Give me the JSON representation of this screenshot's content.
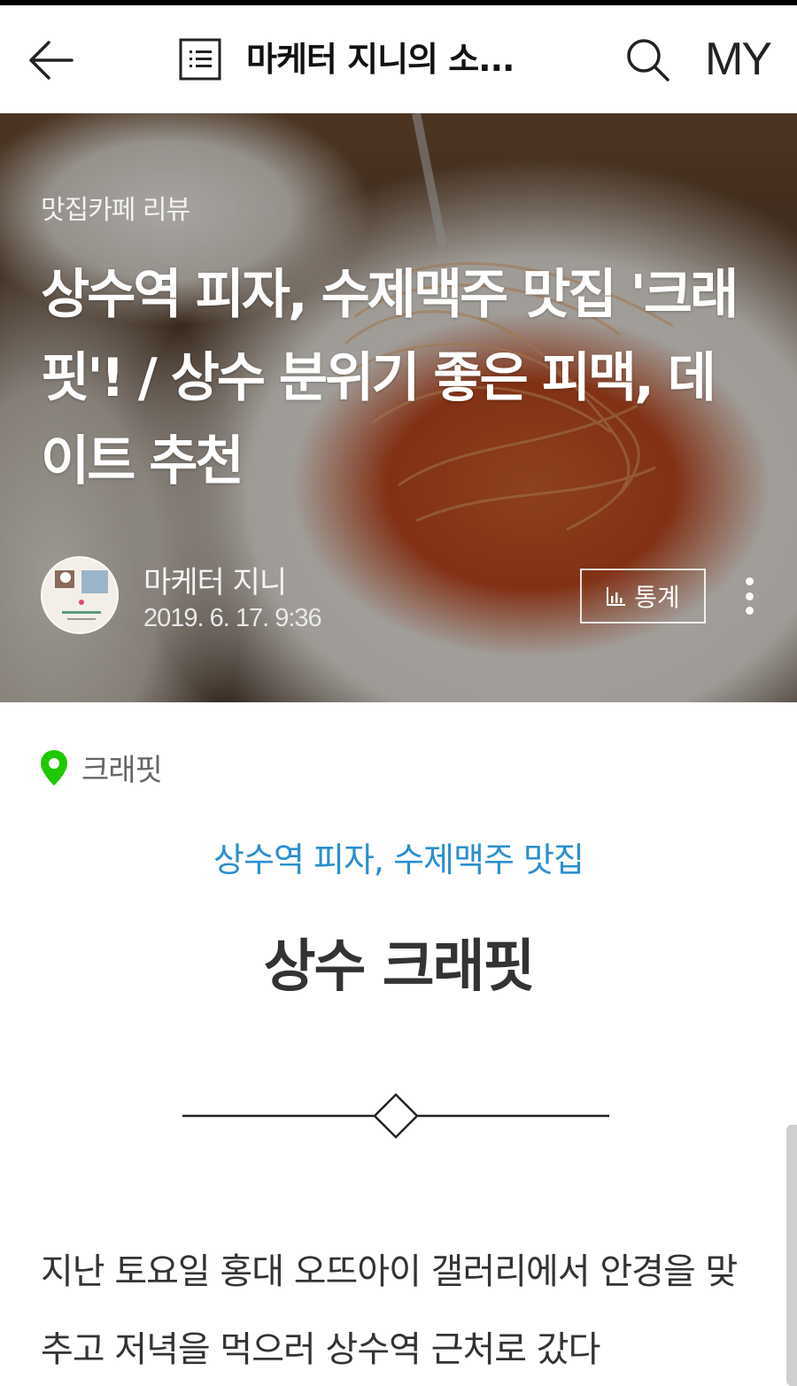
{
  "appbar": {
    "blog_title": "마케터 지니의 소...",
    "my_label": "MY"
  },
  "post": {
    "category": "맛집카페 리뷰",
    "title": "상수역 피자, 수제맥주 맛집 '크래핏'! / 상수 분위기 좋은 피맥, 데이트 추천",
    "author": "마케터 지니",
    "date": "2019. 6. 17. 9:36",
    "stats_label": "통계"
  },
  "content": {
    "place_name": "크래핏",
    "subtitle": "상수역 피자, 수제맥주 맛집",
    "heading": "상수 크래핏",
    "paragraph": "지난 토요일 홍대 오뜨아이 갤러리에서 안경을 맞추고 저녁을 먹으러 상수역 근처로 갔다"
  },
  "colors": {
    "accent_blue": "#2a8fd0",
    "place_pin_green": "#1ec800"
  },
  "icons": [
    "back-arrow-icon",
    "list-icon",
    "search-icon",
    "stats-icon",
    "more-icon",
    "map-pin-icon"
  ]
}
